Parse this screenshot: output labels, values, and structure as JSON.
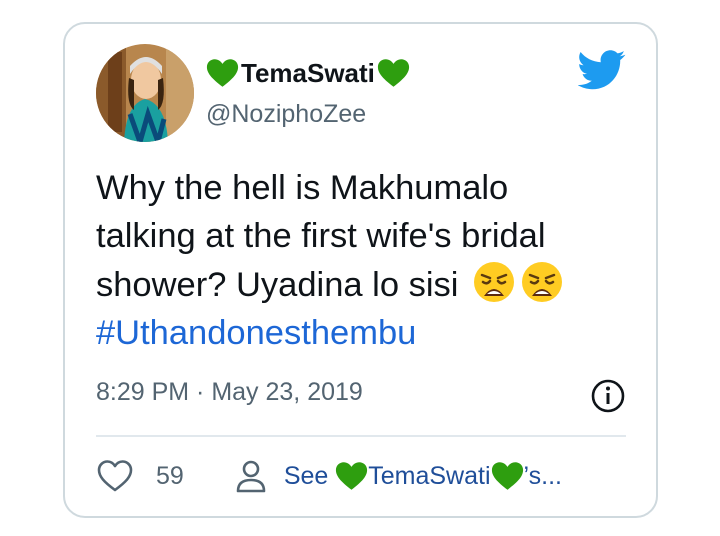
{
  "tweet": {
    "display_name": "TemaSwati",
    "handle": "@NoziphoZee",
    "text_line1": "Why the hell is Makhumalo",
    "text_line2": "talking at the first wife's bridal",
    "text_line3": "shower? Uyadina lo sisi",
    "hashtag": "#Uthandonesthembu",
    "timestamp": "8:29 PM · May 23, 2019",
    "like_count": "59",
    "see_prefix": "See",
    "see_name": "TemaSwati",
    "see_suffix": "’s..."
  },
  "icons": {
    "heart_emoji": "green-heart-icon",
    "twitter": "twitter-bird-icon",
    "emoji": "weary-face-emoji",
    "info": "info-icon",
    "like": "heart-outline-icon",
    "profile": "person-icon"
  },
  "colors": {
    "accent": "#1d9bf0",
    "link": "#1d67d6",
    "green_heart": "#2e9e0f",
    "muted": "#536471"
  }
}
